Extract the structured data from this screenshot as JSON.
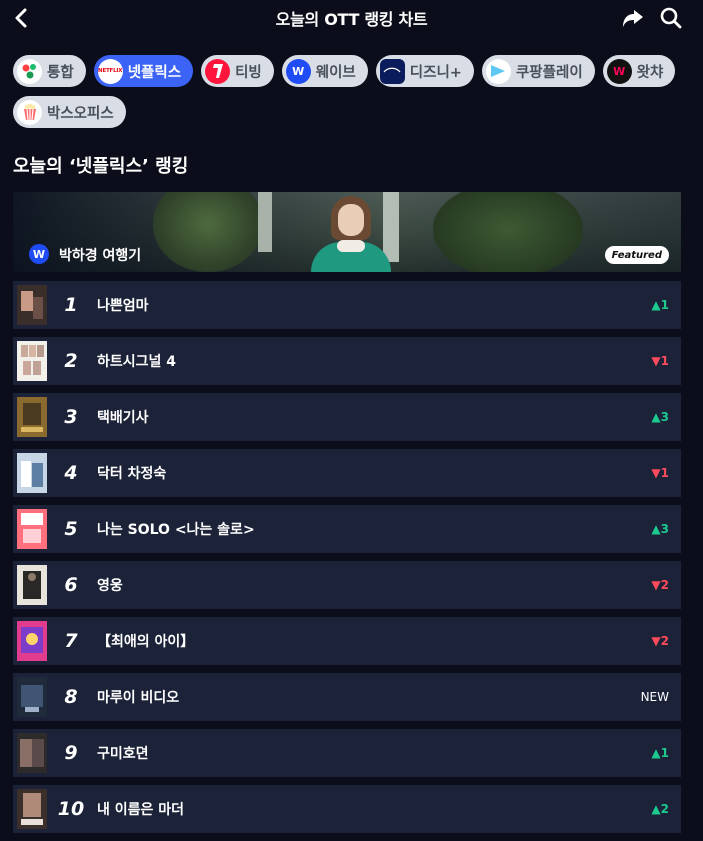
{
  "header": {
    "title": "오늘의 OTT 랭킹 차트"
  },
  "icons": [
    "chevron-left-icon",
    "share-icon",
    "search-icon"
  ],
  "platforms": [
    {
      "label": "통합",
      "logo": "all-logo",
      "logo_text": "",
      "active": false
    },
    {
      "label": "넷플릭스",
      "logo": "netflix-logo",
      "logo_text": "NETFLIX",
      "active": true
    },
    {
      "label": "티빙",
      "logo": "tving-logo",
      "logo_text": "",
      "active": false
    },
    {
      "label": "웨이브",
      "logo": "wavve-logo",
      "logo_text": "W",
      "active": false
    },
    {
      "label": "디즈니+",
      "logo": "disney-logo",
      "logo_text": "",
      "active": false
    },
    {
      "label": "쿠팡플레이",
      "logo": "coupangplay-logo",
      "logo_text": "",
      "active": false
    },
    {
      "label": "왓챠",
      "logo": "watcha-logo",
      "logo_text": "W",
      "active": false
    },
    {
      "label": "박스오피스",
      "logo": "boxoffice-logo",
      "logo_text": "",
      "active": false
    }
  ],
  "section": {
    "title": "오늘의 ‘넷플릭스’ 랭킹"
  },
  "featured": {
    "title": "박하경 여행기",
    "badge": "W",
    "tag": "Featured"
  },
  "colors": {
    "background": "#0b0e1a",
    "row": "#1c2238",
    "accent": "#3b63f6",
    "up": "#1cc98f",
    "down": "#ff4b5c"
  },
  "rankings": [
    {
      "rank": "1",
      "title": "나쁜엄마",
      "change": "▲1",
      "dir": "up"
    },
    {
      "rank": "2",
      "title": "하트시그널 4",
      "change": "▼1",
      "dir": "down"
    },
    {
      "rank": "3",
      "title": "택배기사",
      "change": "▲3",
      "dir": "up"
    },
    {
      "rank": "4",
      "title": "닥터 차정숙",
      "change": "▼1",
      "dir": "down"
    },
    {
      "rank": "5",
      "title": "나는 SOLO <나는 솔로>",
      "change": "▲3",
      "dir": "up"
    },
    {
      "rank": "6",
      "title": "영웅",
      "change": "▼2",
      "dir": "down"
    },
    {
      "rank": "7",
      "title": "【최애의 아이】",
      "change": "▼2",
      "dir": "down"
    },
    {
      "rank": "8",
      "title": "마루이 비디오",
      "change": "NEW",
      "dir": "new"
    },
    {
      "rank": "9",
      "title": "구미호뎐",
      "change": "▲1",
      "dir": "up"
    },
    {
      "rank": "10",
      "title": "내 이름은 마더",
      "change": "▲2",
      "dir": "up"
    }
  ]
}
